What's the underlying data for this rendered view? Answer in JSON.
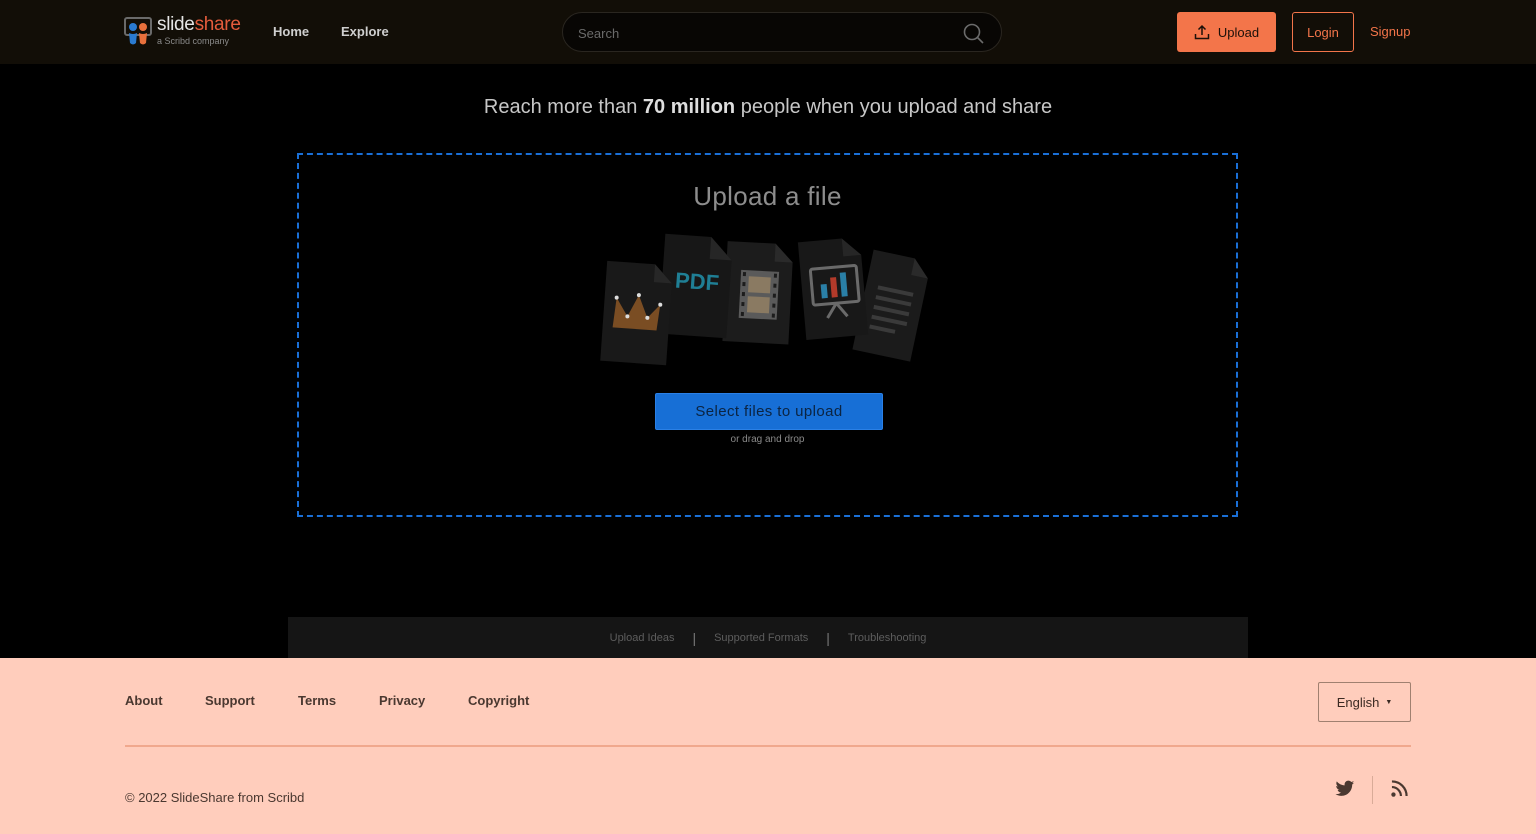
{
  "header": {
    "logo_name": "slide",
    "logo_name_accent": "share",
    "logo_tagline": "a Scribd company",
    "nav": [
      {
        "label": "Home"
      },
      {
        "label": "Explore"
      }
    ],
    "search_placeholder": "Search",
    "search_icon": "search-icon",
    "upload_label": "Upload",
    "upload_icon": "upload-icon",
    "login_label": "Login",
    "signup_label": "Signup"
  },
  "main": {
    "tagline_pre": "Reach more than",
    "tagline_bold": "70 million",
    "tagline_post": "people when you upload and share",
    "upload_title": "Upload a file",
    "file_type_icons": [
      "presentation-crown-icon",
      "pdf-file-icon",
      "video-file-icon",
      "slideshow-chart-icon",
      "text-document-icon"
    ],
    "pdf_label": "PDF",
    "select_button": "Select files to upload",
    "drag_hint": "or drag and drop"
  },
  "help_bar": {
    "links": [
      {
        "label": "Upload Ideas"
      },
      {
        "label": "Supported Formats"
      },
      {
        "label": "Troubleshooting"
      }
    ],
    "separator": "|"
  },
  "footer": {
    "links": [
      {
        "label": "About"
      },
      {
        "label": "Support"
      },
      {
        "label": "Terms"
      },
      {
        "label": "Privacy"
      },
      {
        "label": "Copyright"
      }
    ],
    "language": "English",
    "copyright": "© 2022 SlideShare from Scribd",
    "social_icons": [
      "twitter-icon",
      "rss-icon"
    ]
  },
  "colors": {
    "header_bg": "#120e07",
    "accent_orange": "#f3754a",
    "primary_blue": "#176fd6",
    "footer_bg": "#ffcdbc"
  }
}
